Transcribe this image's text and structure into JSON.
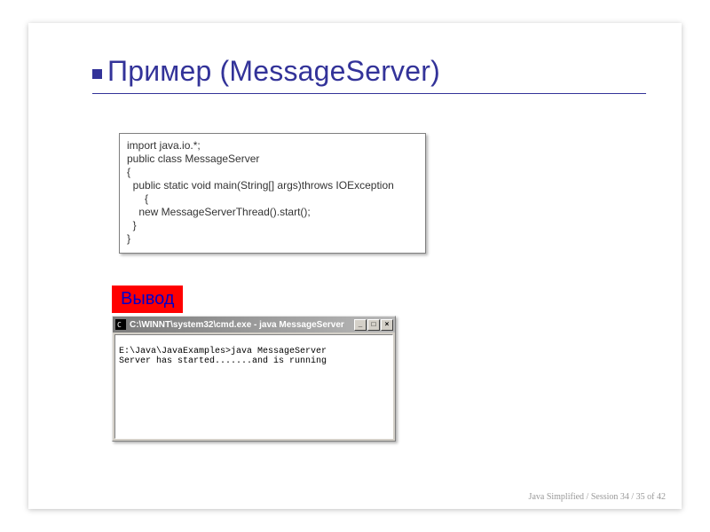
{
  "title": "Пример (MessageServer)",
  "code": "import java.io.*;\npublic class MessageServer\n{\n  public static void main(String[] args)throws IOException\n      {\n    new MessageServerThread().start();\n  }\n}",
  "output_label": "Вывод",
  "console": {
    "title": "C:\\WINNT\\system32\\cmd.exe - java MessageServer",
    "body": "\nE:\\Java\\JavaExamples>java MessageServer\nServer has started.......and is running",
    "buttons": {
      "min": "_",
      "max": "□",
      "close": "×"
    }
  },
  "footer": "Java Simplified / Session 34 /  35 of  42"
}
